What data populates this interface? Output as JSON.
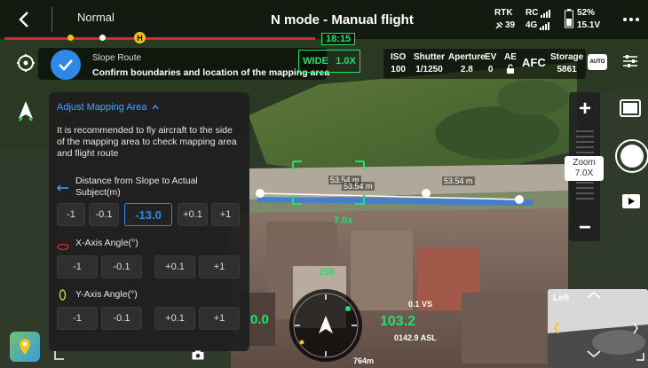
{
  "topbar": {
    "back_icon": "back-chevron-icon",
    "mode_label": "Normal",
    "title": "N mode - Manual flight",
    "rtk_label": "RTK",
    "rtk_value": "39",
    "rc_label": "RC",
    "rc_network": "4G",
    "battery_percent": "52%",
    "battery_voltage": "15.1V",
    "more_icon": "more-dots-icon"
  },
  "timeline": {
    "time": "18:15",
    "home_badge": "H"
  },
  "banner": {
    "title": "Slope Route",
    "message": "Confirm boundaries and location of the mapping area"
  },
  "lens": {
    "wide_label": "WIDE",
    "zoom_label": "1.0X"
  },
  "camera": {
    "iso_label": "ISO",
    "iso_value": "100",
    "shutter_label": "Shutter",
    "shutter_value": "1/1250",
    "aperture_label": "Aperture",
    "aperture_value": "2.8",
    "ev_label": "EV",
    "ev_value": "0",
    "ae_label": "AE",
    "focus_mode": "AFC",
    "storage_label": "Storage",
    "storage_value": "5861"
  },
  "panel": {
    "header": "Adjust Mapping Area",
    "description": "It is recommended to fly aircraft to the side of the mapping area to check mapping area and flight route",
    "distance_label": "Distance from Slope to Actual Subject(m)",
    "distance_buttons": [
      "-1",
      "-0.1",
      "-13.0",
      "+0.1",
      "+1"
    ],
    "x_label": "X-Axis Angle(°)",
    "x_buttons": [
      "-1",
      "-0.1",
      "+0.1",
      "+1"
    ],
    "y_label": "Y-Axis Angle(°)",
    "y_buttons": [
      "-1",
      "-0.1",
      "+0.1",
      "+1"
    ]
  },
  "map_labels": {
    "dist1": "53.54 m",
    "dist2": "53.54 m",
    "dist3": "53.54 m",
    "target_zoom": "7.0x"
  },
  "zoom": {
    "plus": "+",
    "minus": "−",
    "label": "Zoom",
    "value": "7.0X"
  },
  "telemetry": {
    "heading": "298",
    "hs_left": "0.0",
    "altitude": "103.2",
    "vs": "0.1 VS",
    "asl": "0142.9 ASL",
    "distance": "764m"
  },
  "minimap": {
    "label": "Left"
  },
  "colors": {
    "accent": "#2d89e5",
    "flight_green": "#22e06a",
    "alert_red": "#e0242f",
    "home_yellow": "#f0c419"
  }
}
